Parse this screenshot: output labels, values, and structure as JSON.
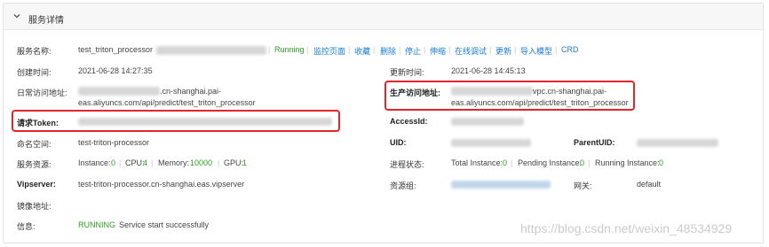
{
  "panel": {
    "title": "服务详情",
    "collapse_icon": "chevron-down-icon"
  },
  "service": {
    "name_label": "服务名称:",
    "name_value": "test_triton_processor",
    "status": "Running",
    "actions": [
      "监控页面",
      "收藏",
      "删除",
      "停止",
      "伸缩",
      "在线调试",
      "更新",
      "导入模型",
      "CRD"
    ],
    "create_time_label": "创建时间:",
    "create_time": "2021-06-28 14:27:35",
    "update_time_label": "更新时间:",
    "update_time": "2021-06-28 14:45:13",
    "daily_addr_label": "日常访问地址:",
    "daily_addr_line1": ".cn-shanghai.pai-",
    "daily_addr_line2": "eas.aliyuncs.com/api/predict/test_triton_processor",
    "prod_addr_label": "生产访问地址:",
    "prod_addr_line1": "vpc.cn-shanghai.pai-",
    "prod_addr_line2": "eas.aliyuncs.com/api/predict/test_triton_processor",
    "token_label": "请求Token:",
    "accessid_label": "AccessId:",
    "namespace_label": "命名空间:",
    "namespace": "test-triton-processor",
    "uid_label": "UID:",
    "parentuid_label": "ParentUID:",
    "resource_label": "服务资源:",
    "instance_label": "Instance:",
    "instance_value": "0",
    "cpu_label": "CPU:",
    "cpu_value": "4",
    "memory_label": "Memory:",
    "memory_value": "10000",
    "gpu_label": "GPU:",
    "gpu_value": "1",
    "process_label": "进程状态:",
    "total_instance_label": "Total Instance:",
    "total_instance_value": "0",
    "pending_instance_label": "Pending Instance:",
    "pending_instance_value": "0",
    "running_instance_label": "Running Instance:",
    "running_instance_value": "0",
    "vipserver_label": "Vipserver:",
    "vipserver": "test-triton-processor.cn-shanghai.eas.vipserver",
    "resource_group_label": "资源组:",
    "gateway_label": "网关:",
    "gateway": "default",
    "image_label": "镜像地址:",
    "info_label": "信息:",
    "info_status": "RUNNING",
    "info_message": "Service start successfully"
  },
  "watermark": "https://blog.csdn.net/weixin_48534929",
  "colors": {
    "link": "#1a7bd4",
    "success": "#2ea121",
    "highlight": "#e0262b"
  }
}
